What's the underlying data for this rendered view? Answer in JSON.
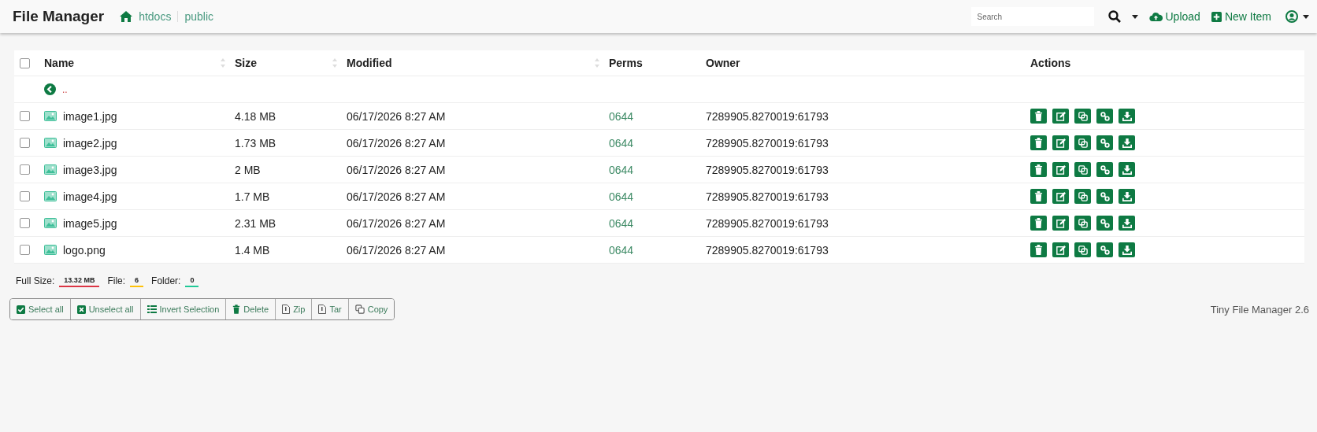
{
  "navbar": {
    "title": "File Manager",
    "breadcrumb": [
      "htdocs",
      "public"
    ],
    "search": {
      "placeholder": "Search"
    },
    "actions": [
      {
        "kind": "upload",
        "label": "Upload"
      },
      {
        "kind": "new",
        "label": "New Item"
      }
    ]
  },
  "table": {
    "columns": [
      {
        "label": "Name",
        "sortable": true
      },
      {
        "label": "Size",
        "sortable": true
      },
      {
        "label": "Modified",
        "sortable": true
      },
      {
        "label": "Perms",
        "sortable": false
      },
      {
        "label": "Owner",
        "sortable": false
      },
      {
        "label": "Actions",
        "sortable": false
      }
    ],
    "select_all_checked": false,
    "parent_row": {
      "label": ".."
    },
    "rows": [
      {
        "name": "image1.jpg",
        "size": "4.18 MB",
        "modified": "06/17/2026 8:27 AM",
        "perms": "0644",
        "owner": "7289905.8270019:61793",
        "checked": false
      },
      {
        "name": "image2.jpg",
        "size": "1.73 MB",
        "modified": "06/17/2026 8:27 AM",
        "perms": "0644",
        "owner": "7289905.8270019:61793",
        "checked": false
      },
      {
        "name": "image3.jpg",
        "size": "2 MB",
        "modified": "06/17/2026 8:27 AM",
        "perms": "0644",
        "owner": "7289905.8270019:61793",
        "checked": false
      },
      {
        "name": "image4.jpg",
        "size": "1.7 MB",
        "modified": "06/17/2026 8:27 AM",
        "perms": "0644",
        "owner": "7289905.8270019:61793",
        "checked": false
      },
      {
        "name": "image5.jpg",
        "size": "2.31 MB",
        "modified": "06/17/2026 8:27 AM",
        "perms": "0644",
        "owner": "7289905.8270019:61793",
        "checked": false
      },
      {
        "name": "logo.png",
        "size": "1.4 MB",
        "modified": "06/17/2026 8:27 AM",
        "perms": "0644",
        "owner": "7289905.8270019:61793",
        "checked": false
      }
    ]
  },
  "summary": [
    {
      "label": "Full Size:",
      "value": "13.32 MB",
      "color": "#dc3545"
    },
    {
      "label": "File:",
      "value": "6",
      "color": "#ffc107"
    },
    {
      "label": "Folder:",
      "value": "0",
      "color": "#20c997"
    }
  ],
  "bulk_buttons": [
    {
      "kind": "check",
      "label": "Select all"
    },
    {
      "kind": "uncheck",
      "label": "Unselect all"
    },
    {
      "kind": "list",
      "label": "Invert Selection"
    },
    {
      "kind": "trash",
      "label": "Delete"
    },
    {
      "kind": "file",
      "label": "Zip"
    },
    {
      "kind": "file",
      "label": "Tar"
    },
    {
      "kind": "copy",
      "label": "Copy"
    }
  ],
  "footer": {
    "credit": "Tiny File Manager 2.6"
  }
}
